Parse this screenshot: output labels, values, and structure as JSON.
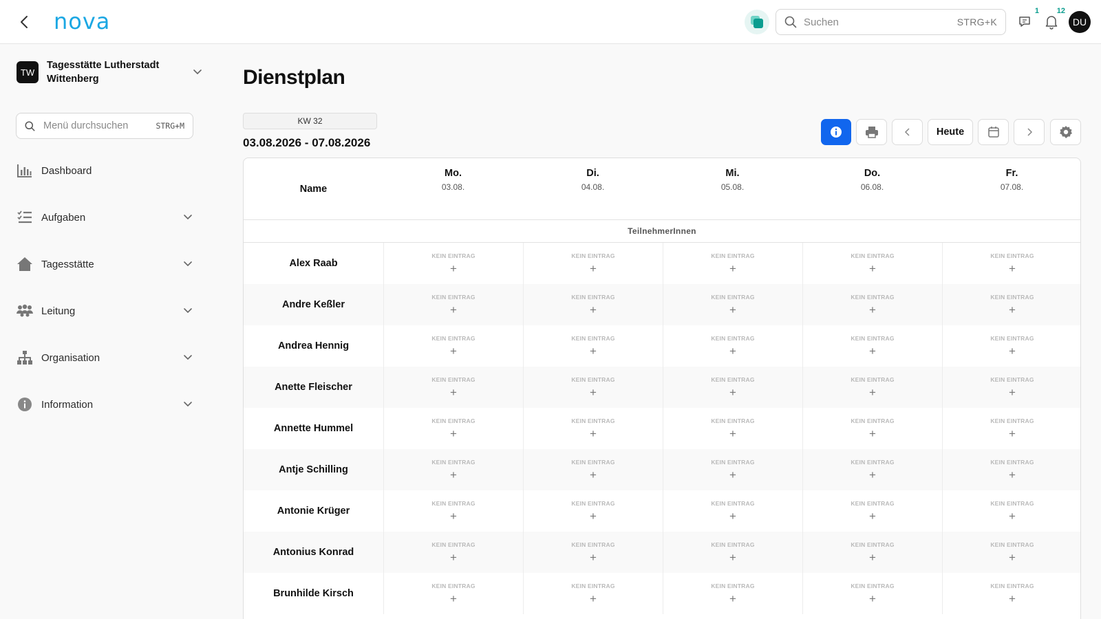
{
  "header": {
    "logo": "nova",
    "search_placeholder": "Suchen",
    "search_shortcut": "STRG+K",
    "messages_badge": "1",
    "notifications_badge": "12",
    "avatar_initials": "DU"
  },
  "sidebar": {
    "org_initials": "TW",
    "org_name": "Tagesstätte Lutherstadt Wittenberg",
    "menu_search_placeholder": "Menü durchsuchen",
    "menu_search_shortcut": "STRG+M",
    "items": [
      {
        "label": "Dashboard",
        "icon": "bar-chart-icon",
        "expandable": false
      },
      {
        "label": "Aufgaben",
        "icon": "checklist-icon",
        "expandable": true
      },
      {
        "label": "Tagesstätte",
        "icon": "home-icon",
        "expandable": true
      },
      {
        "label": "Leitung",
        "icon": "users-icon",
        "expandable": true
      },
      {
        "label": "Organisation",
        "icon": "org-chart-icon",
        "expandable": true
      },
      {
        "label": "Information",
        "icon": "info-icon",
        "expandable": true
      }
    ]
  },
  "main": {
    "title": "Dienstplan",
    "week_chip": "KW 32",
    "date_range": "03.08.2026 - 07.08.2026",
    "toolbar": {
      "today_label": "Heute"
    },
    "table": {
      "name_header": "Name",
      "days": [
        {
          "day": "Mo.",
          "date": "03.08."
        },
        {
          "day": "Di.",
          "date": "04.08."
        },
        {
          "day": "Mi.",
          "date": "05.08."
        },
        {
          "day": "Do.",
          "date": "06.08."
        },
        {
          "day": "Fr.",
          "date": "07.08."
        }
      ],
      "group_label": "TeilnehmerInnen",
      "empty_label": "KEIN EINTRAG",
      "add_symbol": "+",
      "rows": [
        "Alex Raab",
        "Andre Keßler",
        "Andrea Hennig",
        "Anette Fleischer",
        "Annette Hummel",
        "Antje Schilling",
        "Antonie Krüger",
        "Antonius Konrad",
        "Brunhilde Kirsch"
      ]
    }
  },
  "colors": {
    "brand": "#1ba7e3",
    "primary_button": "#1166ee",
    "badge": "#0a9d8f",
    "app_switch": "#0a9d8f"
  }
}
